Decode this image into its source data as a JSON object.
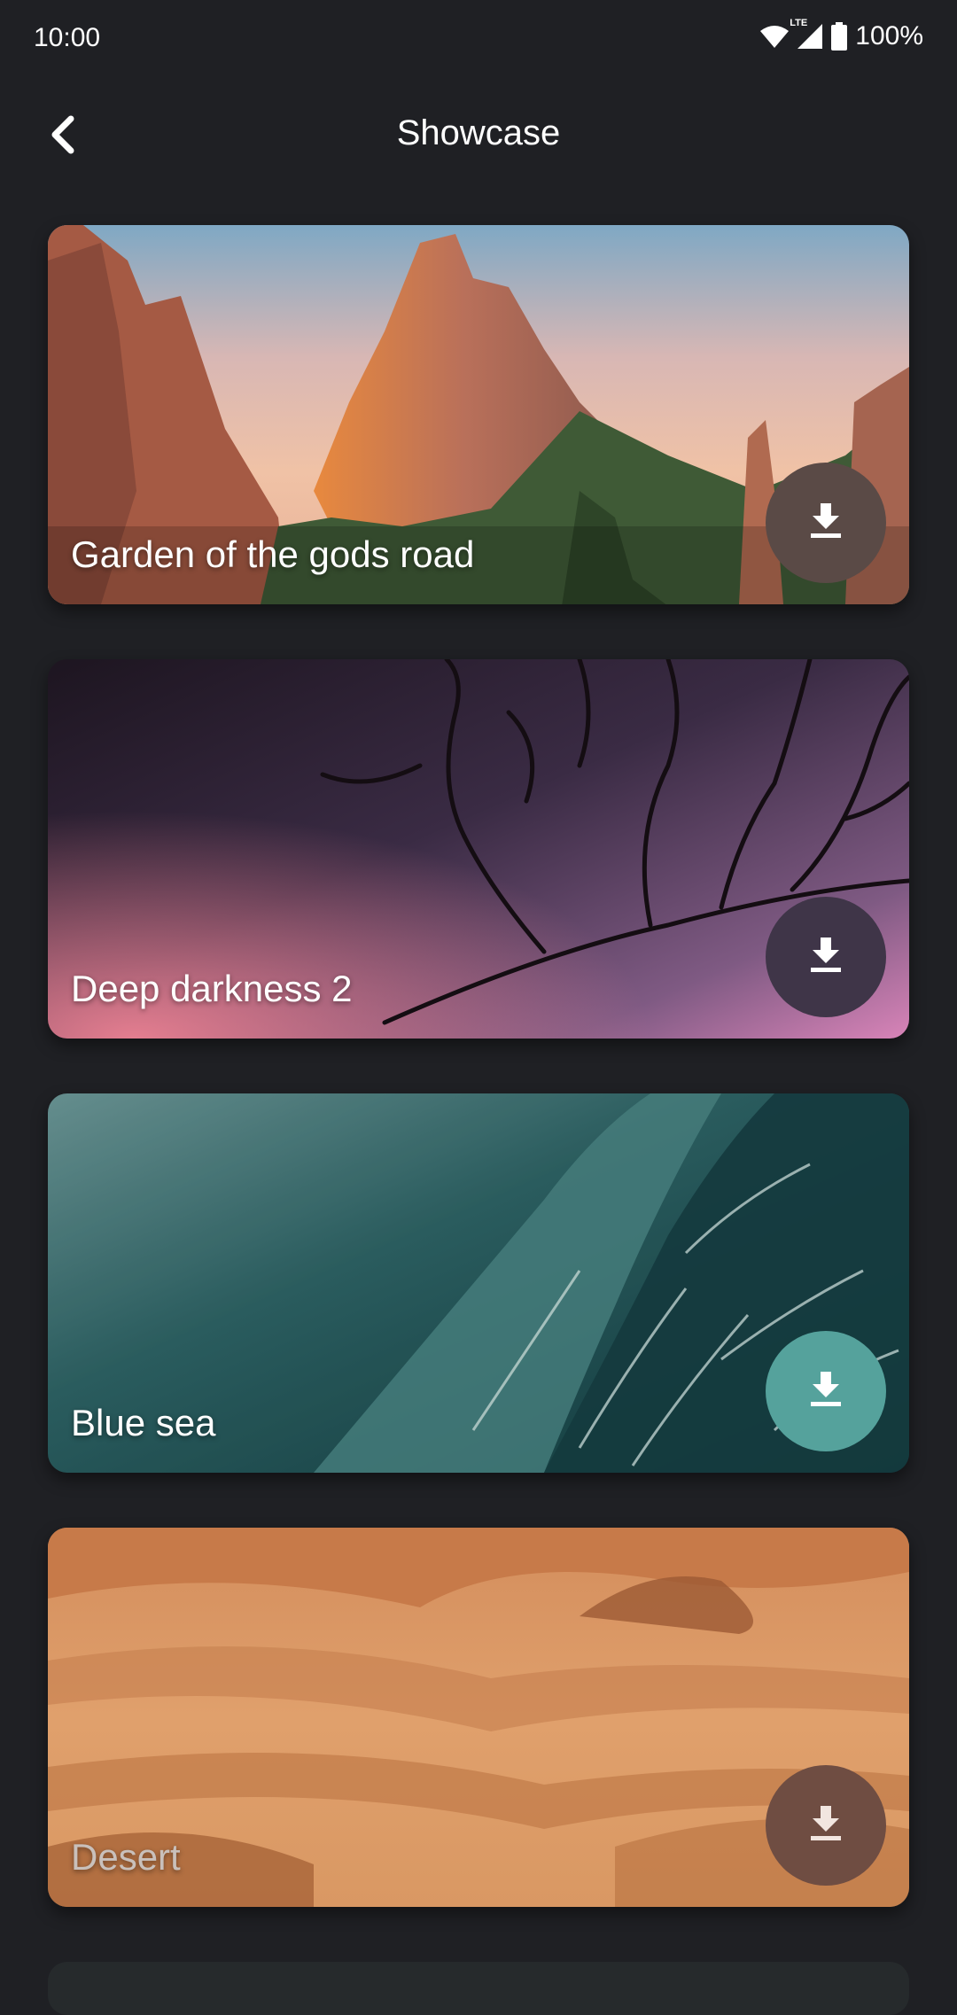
{
  "status_bar": {
    "time": "10:00",
    "network": "LTE",
    "battery": "100%",
    "icons": [
      "wifi-icon",
      "signal-icon",
      "battery-icon"
    ]
  },
  "app_bar": {
    "title": "Showcase",
    "back_icon": "chevron-left-icon"
  },
  "cards": [
    {
      "title": "Garden of the gods road",
      "button_color": "#5a4a46",
      "download_icon": "download-icon"
    },
    {
      "title": "Deep darkness 2",
      "button_color": "#3f3548",
      "download_icon": "download-icon"
    },
    {
      "title": "Blue sea",
      "button_color": "#55a29c",
      "download_icon": "download-icon"
    },
    {
      "title": "Desert",
      "button_color": "#6f4d42",
      "download_icon": "download-icon"
    }
  ],
  "colors": {
    "background": "#1f2024",
    "text": "#ffffff"
  }
}
